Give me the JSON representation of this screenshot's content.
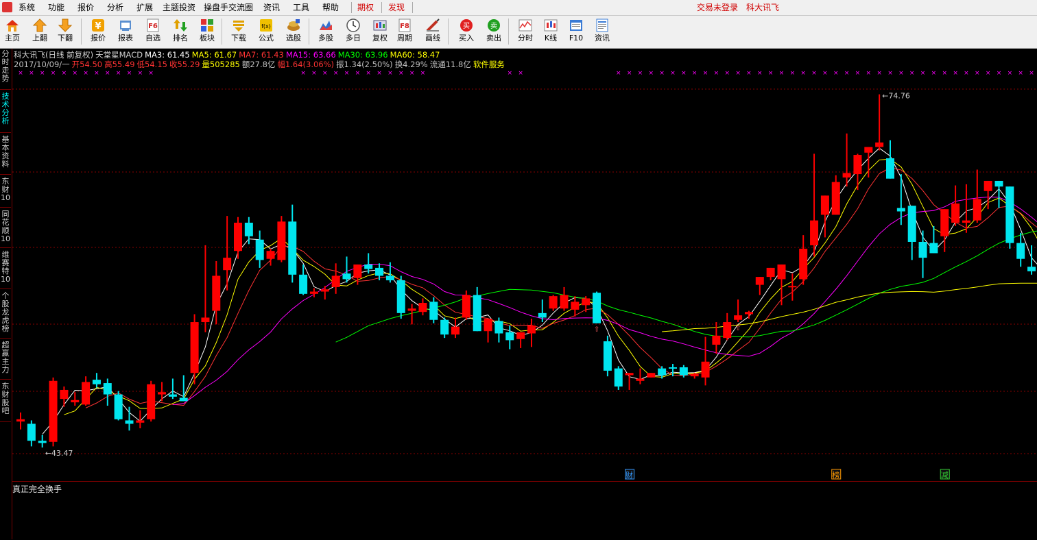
{
  "menubar": {
    "items": [
      "系统",
      "功能",
      "报价",
      "分析",
      "扩展",
      "主题投资",
      "操盘手交流圈",
      "资讯",
      "工具",
      "帮助"
    ],
    "red_items": [
      "期权",
      "发现"
    ],
    "login_status": "交易未登录",
    "product": "科大讯飞"
  },
  "toolbar": {
    "buttons": [
      {
        "label": "主页",
        "icon": "home-icon"
      },
      {
        "label": "上翻",
        "icon": "arrow-up-icon"
      },
      {
        "label": "下翻",
        "icon": "arrow-down-icon"
      },
      {
        "label": "报价",
        "icon": "yen-icon"
      },
      {
        "label": "报表",
        "icon": "report-icon"
      },
      {
        "label": "自选",
        "icon": "f6-icon"
      },
      {
        "label": "排名",
        "icon": "rank-icon"
      },
      {
        "label": "板块",
        "icon": "blocks-icon"
      },
      {
        "label": "下载",
        "icon": "download-icon"
      },
      {
        "label": "公式",
        "icon": "formula-icon"
      },
      {
        "label": "选股",
        "icon": "stock-pick-icon"
      },
      {
        "label": "多股",
        "icon": "multi-stock-icon"
      },
      {
        "label": "多日",
        "icon": "clock-icon"
      },
      {
        "label": "复权",
        "icon": "restore-icon"
      },
      {
        "label": "周期",
        "icon": "f8-icon"
      },
      {
        "label": "画线",
        "icon": "draw-line-icon"
      },
      {
        "label": "买入",
        "icon": "buy-icon"
      },
      {
        "label": "卖出",
        "icon": "sell-icon"
      },
      {
        "label": "分时",
        "icon": "intraday-icon"
      },
      {
        "label": "K线",
        "icon": "kline-icon"
      },
      {
        "label": "F10",
        "icon": "f10-icon"
      },
      {
        "label": "资讯",
        "icon": "news-icon"
      }
    ],
    "buy_glyph": "买",
    "sell_glyph": "卖",
    "f6_glyph": "F6",
    "f8_glyph": "F8",
    "fx_glyph": "f(x)",
    "yen_glyph": "¥"
  },
  "sidebar": {
    "tabs": [
      "分时走势",
      "技术分析",
      "基本资料",
      "东财10",
      "同花顺10",
      "维赛特10",
      "个股龙虎榜",
      "超赢主力",
      "东财股吧"
    ],
    "active": "技术分析"
  },
  "chart_header": {
    "stock": "科大讯飞(日线 前复权)",
    "indicator": "天堂星MACD",
    "ma": [
      {
        "label": "MA3: 61.45",
        "color": "#ffffff"
      },
      {
        "label": "MA5: 61.67",
        "color": "#ffff00"
      },
      {
        "label": "MA7: 61.43",
        "color": "#ff3333"
      },
      {
        "label": "MA15: 63.66",
        "color": "#ff00ff"
      },
      {
        "label": "MA30: 63.96",
        "color": "#00ff00"
      },
      {
        "label": "MA60: 58.47",
        "color": "#ffff00"
      }
    ],
    "quote": [
      {
        "label": "2017/10/09/一",
        "color": "#c0c0c0"
      },
      {
        "label": "开54.50",
        "color": "#ff3333"
      },
      {
        "label": "高55.49",
        "color": "#ff3333"
      },
      {
        "label": "低54.15",
        "color": "#ff3333"
      },
      {
        "label": "收55.29",
        "color": "#ff3333"
      },
      {
        "label": "量505285",
        "color": "#ffff00"
      },
      {
        "label": "额27.8亿",
        "color": "#c0c0c0"
      },
      {
        "label": "幅1.64(3.06%)",
        "color": "#ff3333"
      },
      {
        "label": "振1.34(2.50%)",
        "color": "#c0c0c0"
      },
      {
        "label": "换4.29%",
        "color": "#c0c0c0"
      },
      {
        "label": "流通11.8亿",
        "color": "#c0c0c0"
      },
      {
        "label": "软件服务",
        "color": "#ffff00"
      }
    ]
  },
  "chart_data": {
    "type": "candlestick",
    "period": "daily",
    "up_color": "#ff0000",
    "down_color": "#00e5ee",
    "ylim": [
      41.5,
      76.5
    ],
    "max_label": "74.76",
    "min_label": "43.47",
    "candles": [
      [
        45.8,
        46.6,
        45.1,
        46.0
      ],
      [
        45.6,
        45.9,
        43.6,
        44.1
      ],
      [
        44.1,
        44.6,
        43.5,
        43.9
      ],
      [
        44.0,
        49.7,
        43.6,
        49.4
      ],
      [
        47.8,
        48.9,
        47.1,
        48.6
      ],
      [
        47.5,
        48.4,
        47.2,
        47.7
      ],
      [
        47.3,
        49.8,
        47.2,
        49.3
      ],
      [
        49.5,
        50.1,
        48.8,
        49.1
      ],
      [
        49.2,
        49.6,
        47.2,
        48.2
      ],
      [
        48.2,
        48.5,
        45.9,
        46.0
      ],
      [
        45.9,
        47.1,
        45.0,
        45.6
      ],
      [
        45.7,
        46.8,
        45.2,
        45.9
      ],
      [
        46.0,
        49.4,
        45.8,
        49.1
      ],
      [
        48.2,
        49.3,
        47.6,
        48.4
      ],
      [
        48.2,
        49.6,
        47.8,
        48.0
      ],
      [
        47.9,
        49.9,
        47.6,
        47.6
      ],
      [
        50.1,
        55.3,
        49.1,
        54.6
      ],
      [
        54.6,
        61.4,
        53.7,
        55.0
      ],
      [
        55.6,
        60.0,
        54.4,
        58.7
      ],
      [
        59.2,
        64.0,
        57.4,
        60.3
      ],
      [
        60.9,
        63.9,
        60.2,
        63.4
      ],
      [
        63.4,
        63.9,
        61.5,
        62.2
      ],
      [
        61.9,
        62.7,
        59.4,
        60.1
      ],
      [
        60.2,
        61.1,
        59.6,
        60.9
      ],
      [
        60.1,
        64.0,
        59.9,
        63.5
      ],
      [
        63.5,
        65.0,
        58.1,
        58.8
      ],
      [
        58.8,
        59.7,
        57.0,
        57.1
      ],
      [
        57.1,
        57.6,
        56.8,
        57.3
      ],
      [
        57.3,
        57.8,
        56.6,
        57.5
      ],
      [
        57.7,
        59.8,
        57.1,
        58.7
      ],
      [
        58.9,
        60.4,
        58.1,
        58.4
      ],
      [
        58.5,
        59.6,
        57.9,
        59.7
      ],
      [
        59.7,
        60.7,
        58.9,
        59.3
      ],
      [
        59.4,
        59.8,
        58.3,
        58.7
      ],
      [
        58.7,
        59.9,
        58.1,
        58.3
      ],
      [
        58.3,
        58.7,
        54.9,
        55.4
      ],
      [
        55.6,
        56.2,
        54.4,
        55.8
      ],
      [
        55.5,
        56.7,
        55.2,
        56.3
      ],
      [
        56.4,
        56.8,
        54.5,
        54.8
      ],
      [
        54.8,
        55.0,
        53.2,
        53.5
      ],
      [
        53.5,
        55.0,
        53.2,
        54.2
      ],
      [
        55.0,
        57.4,
        54.8,
        57.0
      ],
      [
        57.0,
        57.7,
        53.8,
        53.8
      ],
      [
        53.8,
        54.9,
        52.8,
        54.9
      ],
      [
        54.7,
        55.0,
        52.8,
        53.6
      ],
      [
        53.7,
        54.3,
        52.2,
        53.0
      ],
      [
        53.1,
        53.7,
        52.3,
        53.7
      ],
      [
        53.6,
        54.9,
        52.4,
        54.3
      ],
      [
        55.4,
        56.6,
        54.6,
        55.0
      ],
      [
        55.8,
        57.0,
        55.6,
        56.9
      ],
      [
        55.8,
        57.7,
        55.6,
        57.0
      ],
      [
        55.7,
        56.9,
        55.1,
        56.4
      ],
      [
        56.1,
        56.9,
        55.5,
        56.7
      ],
      [
        57.2,
        57.3,
        54.5,
        54.5
      ],
      [
        52.9,
        53.4,
        49.8,
        50.3
      ],
      [
        50.5,
        50.7,
        48.6,
        48.9
      ],
      [
        49.9,
        50.1,
        48.6,
        50.1
      ],
      [
        49.4,
        50.5,
        49.1,
        49.6
      ],
      [
        49.7,
        50.0,
        49.7,
        50.1
      ],
      [
        50.5,
        50.7,
        49.6,
        49.9
      ],
      [
        50.6,
        50.9,
        49.8,
        50.5
      ],
      [
        50.6,
        50.8,
        49.7,
        49.9
      ],
      [
        49.8,
        50.1,
        49.6,
        50.0
      ],
      [
        49.7,
        53.3,
        49.0,
        51.1
      ],
      [
        52.6,
        54.6,
        51.8,
        53.4
      ],
      [
        53.2,
        55.4,
        53.0,
        54.6
      ],
      [
        54.8,
        56.6,
        54.6,
        55.2
      ],
      [
        55.3,
        55.6,
        54.9,
        55.5
      ],
      [
        57.9,
        58.6,
        57.0,
        58.6
      ],
      [
        58.6,
        59.4,
        58.3,
        59.4
      ],
      [
        58.4,
        59.4,
        56.1,
        59.7
      ],
      [
        57.7,
        58.9,
        56.5,
        57.8
      ],
      [
        58.4,
        62.3,
        57.9,
        61.1
      ],
      [
        61.4,
        69.5,
        60.4,
        63.6
      ],
      [
        64.1,
        65.3,
        62.1,
        65.8
      ],
      [
        64.1,
        67.6,
        64.9,
        67.0
      ],
      [
        67.4,
        71.3,
        66.6,
        67.8
      ],
      [
        67.7,
        69.5,
        66.3,
        69.4
      ],
      [
        69.6,
        69.6,
        67.4,
        70.1
      ],
      [
        70.1,
        74.76,
        69.8,
        70.5
      ],
      [
        69.1,
        70.7,
        67.3,
        67.3
      ],
      [
        64.7,
        67.7,
        63.2,
        64.4
      ],
      [
        64.9,
        62.0,
        60.1,
        61.7
      ],
      [
        61.7,
        62.7,
        58.5,
        60.3
      ],
      [
        61.6,
        63.1,
        60.7,
        60.7
      ],
      [
        62.2,
        64.2,
        60.8,
        64.6
      ],
      [
        63.4,
        66.7,
        63.1,
        65.1
      ],
      [
        63.4,
        66.8,
        62.5,
        63.6
      ],
      [
        63.6,
        68.1,
        63.4,
        65.5
      ],
      [
        66.2,
        67.0,
        64.6,
        67.1
      ],
      [
        67.1,
        67.1,
        64.7,
        66.6
      ],
      [
        66.6,
        65.1,
        61.1,
        61.6
      ],
      [
        61.6,
        62.5,
        59.5,
        60.2
      ],
      [
        59.5,
        61.4,
        58.8,
        59.1
      ],
      [
        59.1,
        60.1,
        58.2,
        58.3
      ]
    ],
    "ma_lines": [
      {
        "name": "MA3",
        "color": "#ffffff"
      },
      {
        "name": "MA5",
        "color": "#ffff00"
      },
      {
        "name": "MA7",
        "color": "#ff3333"
      },
      {
        "name": "MA15",
        "color": "#ff00ff"
      },
      {
        "name": "MA30",
        "color": "#00ff00"
      },
      {
        "name": "MA60",
        "color": "#ffff00"
      }
    ],
    "event_tags": [
      {
        "label": "财",
        "color": "#3399ff",
        "index": 56
      },
      {
        "label": "榜",
        "color": "#ff9900",
        "index": 75
      },
      {
        "label": "减",
        "color": "#33cc33",
        "index": 85
      }
    ],
    "grid": "dotted-red"
  },
  "sub_panel": {
    "title": "真正完全换手"
  }
}
